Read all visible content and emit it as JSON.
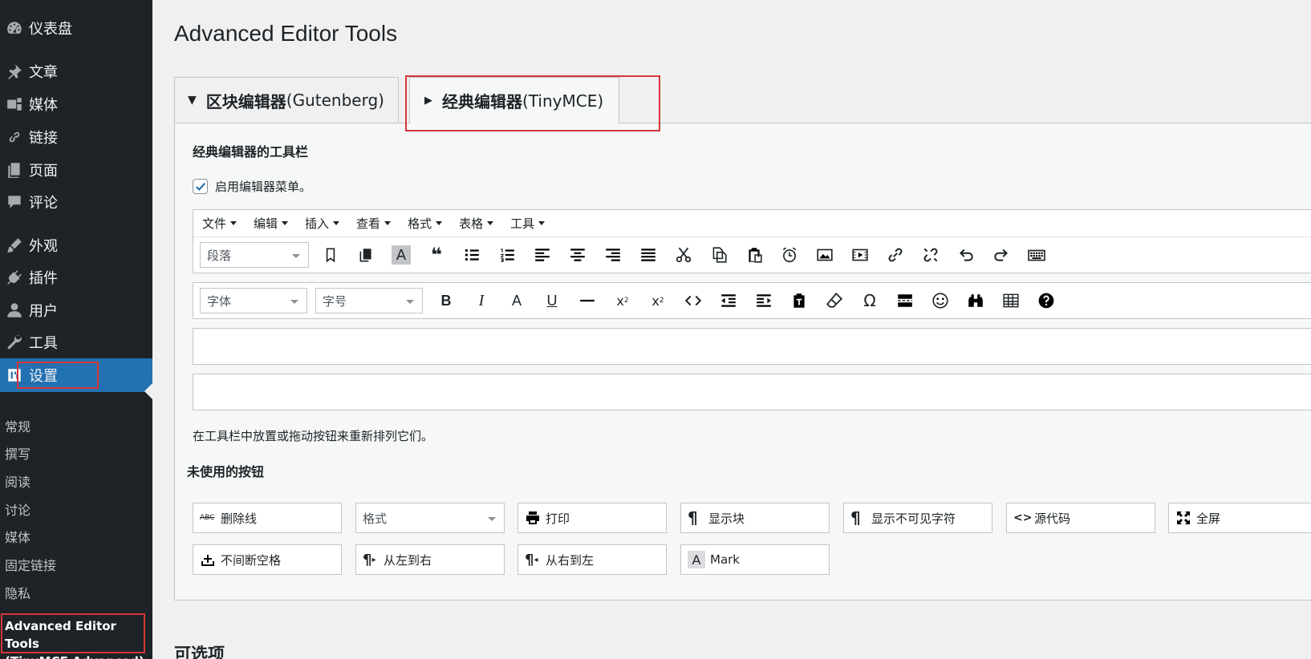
{
  "sidebar": {
    "dashboard": "仪表盘",
    "posts": "文章",
    "media": "媒体",
    "links": "链接",
    "pages": "页面",
    "comments": "评论",
    "appearance": "外观",
    "plugins": "插件",
    "users": "用户",
    "tools": "工具",
    "settings": "设置",
    "submenu": [
      "常规",
      "撰写",
      "阅读",
      "讨论",
      "媒体",
      "固定链接",
      "隐私"
    ],
    "current_submenu_line1": "Advanced Editor Tools",
    "current_submenu_line2": "(TinyMCE Advanced)"
  },
  "page_title": "Advanced Editor Tools",
  "tabs": {
    "gutenberg_bold": "区块编辑器",
    "gutenberg_light": "(Gutenberg)",
    "tinymce_bold": "经典编辑器",
    "tinymce_light": "(TinyMCE)"
  },
  "toolbar_section_title": "经典编辑器的工具栏",
  "enable_menu_label": "启用编辑器菜单。",
  "menubar": [
    "文件",
    "编辑",
    "插入",
    "查看",
    "格式",
    "表格",
    "工具"
  ],
  "toolbar1": {
    "format_select": "段落",
    "icons": [
      "bookmark-icon",
      "copy-icon",
      "text-highlight-icon",
      "blockquote-icon",
      "bullet-list-icon",
      "numbered-list-icon",
      "align-left-icon",
      "align-center-icon",
      "align-right-icon",
      "align-justify-icon",
      "cut-icon",
      "copy-doc-icon",
      "paste-icon",
      "clock-icon",
      "image-icon",
      "media-icon",
      "link-icon",
      "unlink-icon",
      "undo-icon",
      "redo-icon",
      "keyboard-icon"
    ]
  },
  "toolbar2": {
    "font_family_select": "字体",
    "font_size_select": "字号",
    "icons": [
      "bold-icon",
      "italic-icon",
      "font-color-icon",
      "underline-icon",
      "horizontal-line-icon",
      "superscript-icon",
      "subscript-icon",
      "code-icon",
      "outdent-icon",
      "indent-icon",
      "paste-text-icon",
      "eraser-icon",
      "omega-icon",
      "page-break-icon",
      "emoji-icon",
      "find-icon",
      "table-icon",
      "help-icon"
    ]
  },
  "hint_text": "在工具栏中放置或拖动按钮来重新排列它们。",
  "unused_title": "未使用的按钮",
  "unused_buttons": {
    "strikethrough": "删除线",
    "formats": "格式",
    "print": "打印",
    "show_blocks": "显示块",
    "show_invisibles": "显示不可见字符",
    "source_code": "源代码",
    "fullscreen": "全屏",
    "nbsp": "不间断空格",
    "ltr": "从左到右",
    "rtl": "从右到左",
    "mark": "Mark"
  },
  "optional_title": "可选项",
  "colors": {
    "sidebar_bg": "#1d2327",
    "active_blue": "#2271b1",
    "highlight_red": "#d63638"
  }
}
